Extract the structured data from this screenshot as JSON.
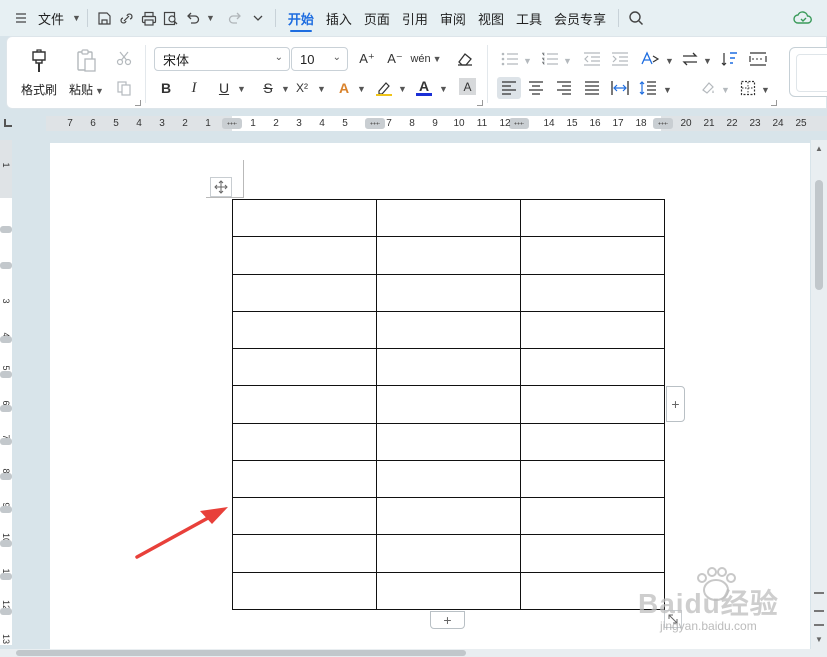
{
  "menubar": {
    "file_label": "文件",
    "tabs": [
      {
        "label": "开始",
        "active": true
      },
      {
        "label": "插入",
        "active": false
      },
      {
        "label": "页面",
        "active": false
      },
      {
        "label": "引用",
        "active": false
      },
      {
        "label": "审阅",
        "active": false
      },
      {
        "label": "视图",
        "active": false
      },
      {
        "label": "工具",
        "active": false
      },
      {
        "label": "会员专享",
        "active": false
      }
    ]
  },
  "ribbon": {
    "format_painter_label": "格式刷",
    "paste_label": "粘贴",
    "font_name": "宋体",
    "font_size": "10",
    "bold": "B",
    "italic": "I",
    "underline": "U",
    "strikethrough": "S",
    "superscript": "X²",
    "font_color_letter": "A",
    "highlight_letter": "A",
    "char_shading_letter": "A",
    "grow_font": "A⁺",
    "shrink_font": "A⁻",
    "phonetic_label": "wén"
  },
  "ruler": {
    "left_numbers": [
      "7",
      "6",
      "5",
      "4",
      "3",
      "2",
      "1"
    ],
    "right_numbers": [
      "1",
      "2",
      "3",
      "4",
      "5",
      "7",
      "8",
      "9",
      "10",
      "11",
      "12",
      "14",
      "15",
      "16",
      "17",
      "18",
      "20",
      "21",
      "22",
      "23",
      "24",
      "25"
    ],
    "vertical_numbers": [
      "1",
      "3",
      "4",
      "5",
      "6",
      "7",
      "8",
      "9",
      "10",
      "1",
      "12",
      "13"
    ]
  },
  "table": {
    "rows": 11,
    "cols": 3
  },
  "colors": {
    "accent": "#1e6de0",
    "arrow": "#e8403a",
    "page_bg": "#d8e4ea"
  },
  "watermark": {
    "brand": "Baidu经验",
    "url": "jingyan.baidu.com"
  }
}
